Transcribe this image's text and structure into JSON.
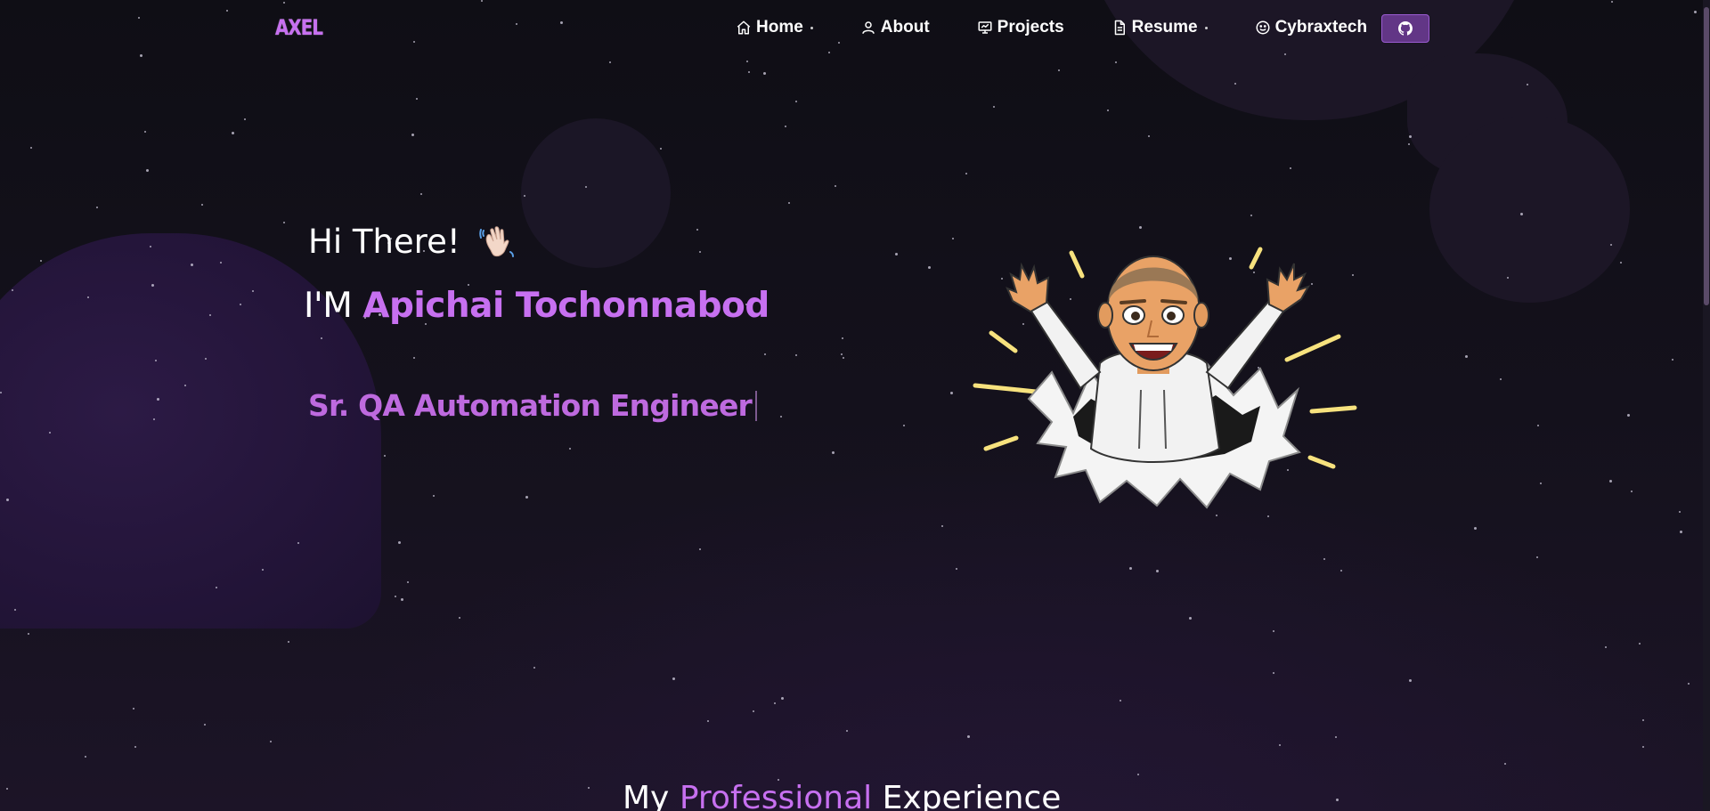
{
  "nav": {
    "logo": "AXEL",
    "items": [
      {
        "label": "Home",
        "icon": "home-icon"
      },
      {
        "label": "About",
        "icon": "user-icon"
      },
      {
        "label": "Projects",
        "icon": "presentation-icon"
      },
      {
        "label": "Resume",
        "icon": "document-icon"
      },
      {
        "label": "Cybraxtech",
        "icon": "smiley-icon"
      }
    ],
    "github_icon": "github-icon"
  },
  "hero": {
    "greeting": "Hi There!",
    "greeting_icon": "waving-hand-icon",
    "name_prefix": "I'M",
    "name": "Apichai Tochonnabod",
    "role": "Sr. QA Automation Engineer"
  },
  "section": {
    "title_before": "My",
    "title_accent": "Professional",
    "title_after": "Experience"
  },
  "colors": {
    "accent": "#c770f0",
    "background": "#0f0e15",
    "button": "#623686"
  }
}
